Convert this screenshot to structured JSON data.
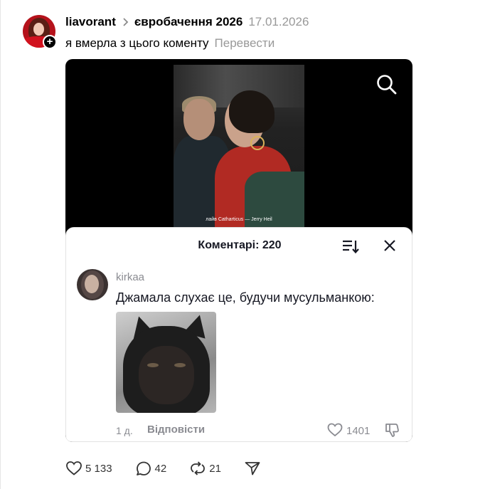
{
  "header": {
    "username": "liavorant",
    "topic": "євробачення 2026",
    "date": "17.01.2026",
    "text": "я вмерла з цього коменту",
    "translate_label": "Перевести"
  },
  "media": {
    "caption": "лайв Catharticus — Jerry Heil"
  },
  "comments_sheet": {
    "title": "Коментарі: 220",
    "comment": {
      "username": "kirkaa",
      "text": "Джамала слухає це, будучи мусульманкою:",
      "time": "1 д.",
      "reply_label": "Відповісти",
      "likes": "1401"
    }
  },
  "actions": {
    "likes": "5 133",
    "comments": "42",
    "reposts": "21"
  },
  "colors": {
    "muted": "#999999",
    "text": "#000000",
    "sheet_muted": "#8a8b91"
  }
}
